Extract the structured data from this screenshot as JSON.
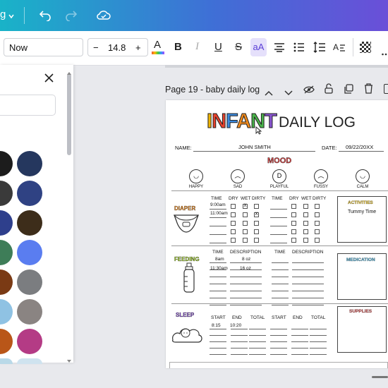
{
  "topbar": {
    "left_fragment": "g"
  },
  "toolbar": {
    "font_name": "Now",
    "minus": "−",
    "font_size": "14.8",
    "plus": "+",
    "color_letter": "A",
    "bold": "B",
    "italic": "I",
    "underline": "U",
    "strike": "S",
    "case": "aA"
  },
  "swatch_colors": [
    "#1c1c1c",
    "#25375e",
    "#3a3a3a",
    "#2f4283",
    "#2e3f8c",
    "#3d2d1a",
    "#3e7d58",
    "#5a7df0",
    "#7a3a14",
    "#7b7d80",
    "#8fc2e3",
    "#8a8482",
    "#b95618",
    "#b43b85"
  ],
  "page": {
    "title": "Page 19 - baby daily log"
  },
  "doc": {
    "title_colored": "INFANT",
    "title_rest": "DAILY LOG",
    "name_label": "NAME:",
    "name_value": "JOHN SMITH",
    "date_label": "DATE:",
    "date_value": "09/22/20XX",
    "mood_title": "MOOD",
    "moods": [
      "HAPPY",
      "SAD",
      "PLAYFUL",
      "FUSSY",
      "CALM"
    ],
    "diaper_label": "DIAPER",
    "diaper_headers": [
      "TIME",
      "DRY",
      "WET",
      "DIRTY"
    ],
    "diaper_times": [
      "9:00am",
      "11:00am"
    ],
    "activities_label": "ACTIVITIES",
    "activities_value": "Tummy Time",
    "feeding_label": "FEEDING",
    "feeding_headers": [
      "TIME",
      "DESCRIPTION"
    ],
    "feeding_rows": [
      [
        "8am",
        "8 oz"
      ],
      [
        "11:30am",
        "16 oz"
      ]
    ],
    "medication_label": "MEDICATION",
    "sleep_label": "SLEEP",
    "sleep_headers": [
      "START",
      "END",
      "TOTAL"
    ],
    "sleep_row": [
      "8:15",
      "10:20"
    ],
    "supplies_label": "SUPPLIES"
  }
}
